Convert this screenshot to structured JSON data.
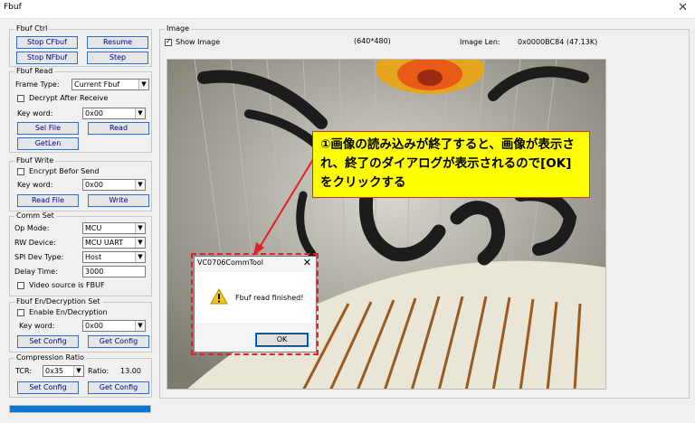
{
  "window": {
    "title": "Fbuf",
    "close_icon": "close-icon"
  },
  "fbuf_ctrl": {
    "title": "Fbuf Ctrl",
    "stop_cfbuf": "Stop CFbuf",
    "resume": "Resume",
    "stop_nfbuf": "Stop NFbuf",
    "step": "Step"
  },
  "fbuf_read": {
    "title": "Fbuf Read",
    "frame_type_label": "Frame Type:",
    "frame_type_value": "Current Fbuf",
    "decrypt_label": "Decrypt After Receive",
    "key_word_label": "Key word:",
    "key_word_value": "0x00",
    "sel_file": "Sel File",
    "read": "Read",
    "getlen": "GetLen"
  },
  "fbuf_write": {
    "title": "Fbuf Write",
    "encrypt_label": "Encrypt Befor Send",
    "key_word_label": "Key word:",
    "key_word_value": "0x00",
    "read_file": "Read File",
    "write": "Write"
  },
  "comm_set": {
    "title": "Comm Set",
    "op_mode_label": "Op Mode:",
    "op_mode_value": "MCU",
    "rw_device_label": "RW Device:",
    "rw_device_value": "MCU UART",
    "spi_dev_label": "SPI Dev Type:",
    "spi_dev_value": "Host",
    "delay_label": "Delay Time:",
    "delay_value": "3000",
    "video_label": "Video source is FBUF"
  },
  "endec": {
    "title": "Fbuf En/Decryption Set",
    "enable_label": "Enable En/Decryption",
    "key_word_label": "Key word:",
    "key_word_value": "0x00",
    "set_config": "Set Config",
    "get_config": "Get Config"
  },
  "compression": {
    "title": "Compression Ratio",
    "tcr_label": "TCR:",
    "tcr_value": "0x35",
    "ratio_label": "Ratio:",
    "ratio_value": "13.00",
    "set_config": "Set Config",
    "get_config": "Get Config"
  },
  "progress": {
    "value": 1.0,
    "color": "#0678d4"
  },
  "image": {
    "title": "Image",
    "show_image_label": "Show Image",
    "resolution": "(640*480)",
    "len_label": "Image Len:",
    "len_value": "0x0000BC84 (47.13K)"
  },
  "dialog": {
    "title": "VC0706CommTool",
    "message": "Fbuf read finished!",
    "ok": "OK",
    "icon": "warning-icon"
  },
  "callout": {
    "text": "①画像の読み込みが終了すると、画像が表示され、終了のダイアログが表示されるので[OK]をクリックする",
    "bg_color": "#ffff00",
    "arrow_color": "#e0202a"
  }
}
